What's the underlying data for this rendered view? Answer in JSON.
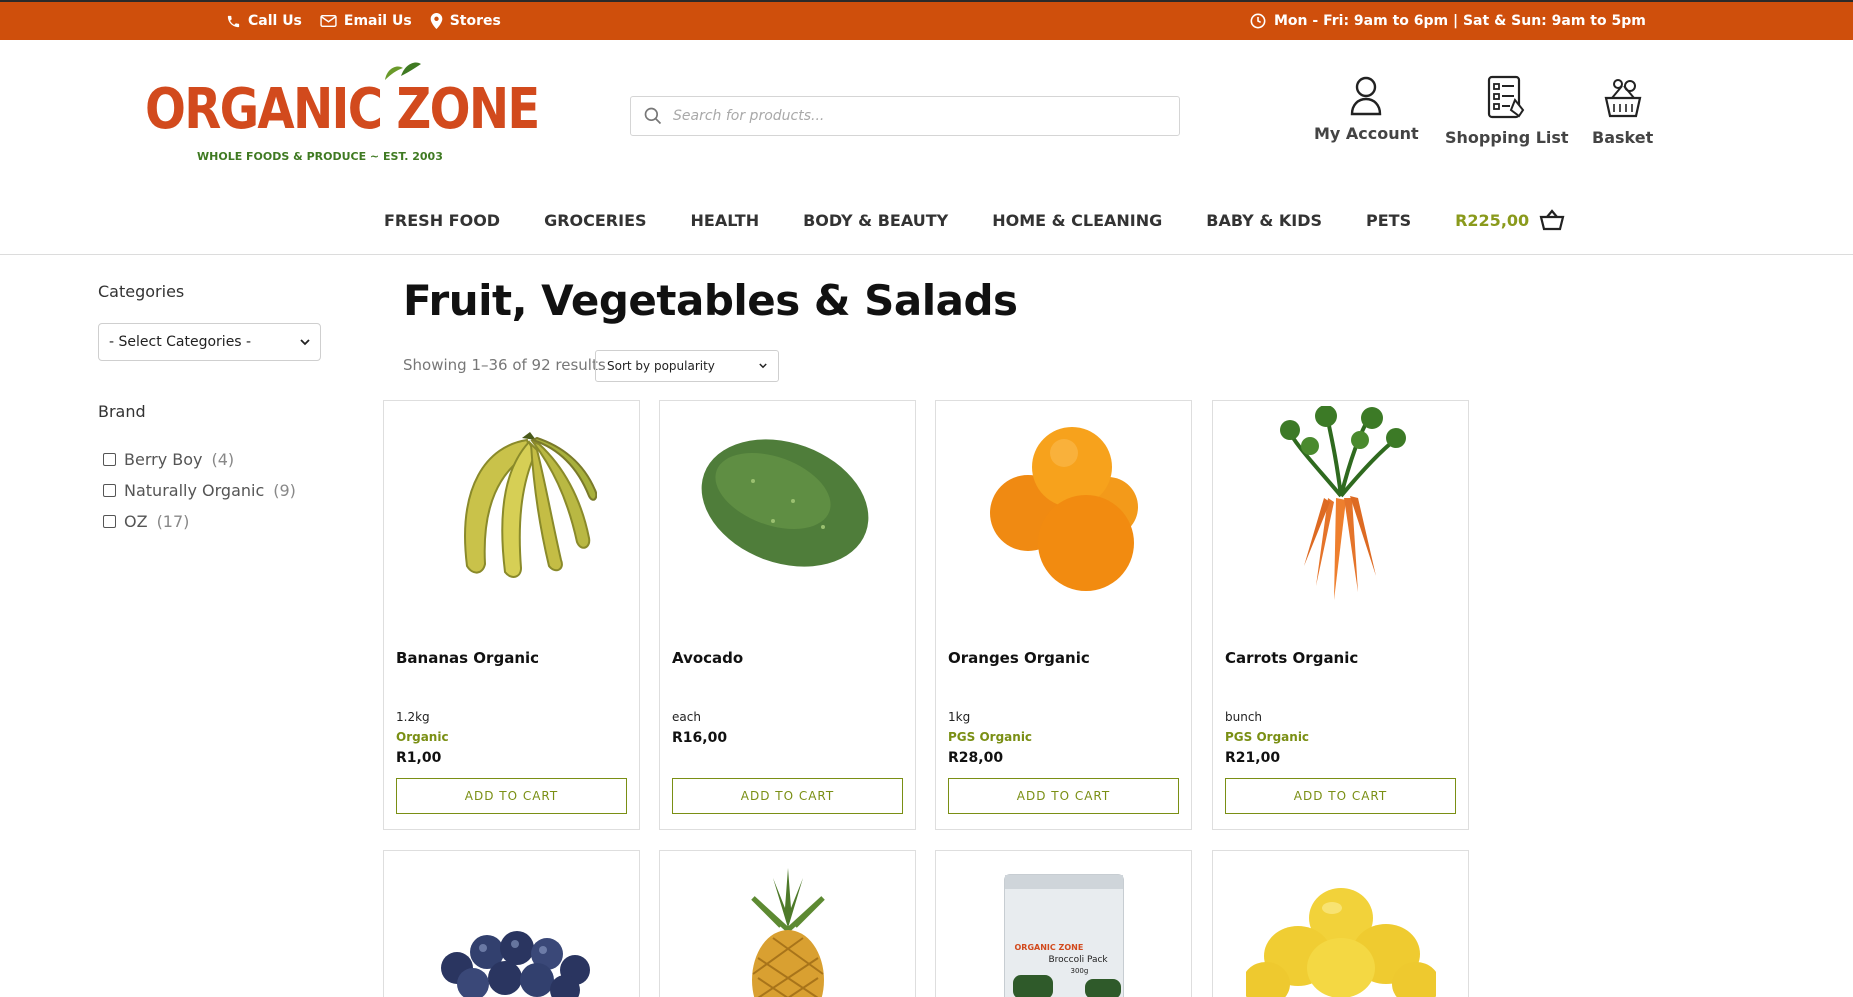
{
  "topbar": {
    "call": "Call Us",
    "email": "Email Us",
    "stores": "Stores",
    "hours": "Mon - Fri: 9am to 6pm | Sat & Sun: 9am to 5pm"
  },
  "logo": {
    "brand": "ORGANIC ZONE",
    "tagline": "WHOLE FOODS & PRODUCE ~ EST. 2003"
  },
  "search": {
    "placeholder": "Search for products..."
  },
  "header_icons": {
    "account": "My Account",
    "shopping_list": "Shopping List",
    "basket": "Basket"
  },
  "nav": {
    "items": [
      "FRESH FOOD",
      "GROCERIES",
      "HEALTH",
      "BODY & BEAUTY",
      "HOME & CLEANING",
      "BABY & KIDS",
      "PETS"
    ],
    "cart_total": "R225,00"
  },
  "sidebar": {
    "categories_heading": "Categories",
    "categories_select": "- Select Categories -",
    "brand_heading": "Brand",
    "brands": [
      {
        "name": "Berry Boy",
        "count": "(4)"
      },
      {
        "name": "Naturally Organic",
        "count": "(9)"
      },
      {
        "name": "OZ",
        "count": "(17)"
      }
    ]
  },
  "main": {
    "title": "Fruit, Vegetables & Salads",
    "results": "Showing 1–36 of 92 results",
    "sort": "Sort by popularity",
    "add_to_cart": "ADD TO CART",
    "products": [
      {
        "name": "Bananas Organic",
        "unit": "1.2kg",
        "badge": "Organic",
        "price": "R1,00",
        "icon": "banana-image"
      },
      {
        "name": "Avocado",
        "unit": "each",
        "badge": "",
        "price": "R16,00",
        "icon": "avocado-image"
      },
      {
        "name": "Oranges Organic",
        "unit": "1kg",
        "badge": "PGS Organic",
        "price": "R28,00",
        "icon": "oranges-image"
      },
      {
        "name": "Carrots Organic",
        "unit": "bunch",
        "badge": "PGS Organic",
        "price": "R21,00",
        "icon": "carrots-image"
      }
    ],
    "row2": [
      {
        "icon": "blueberries-image"
      },
      {
        "icon": "pineapple-image"
      },
      {
        "icon": "broccoli-pack-image",
        "pack_brand": "ORGANIC ZONE",
        "pack_label": "Broccoli Pack",
        "pack_weight": "300g"
      },
      {
        "icon": "lemons-image"
      }
    ]
  },
  "colors": {
    "topbar": "#cf4f0c",
    "accent_green": "#7a8f14",
    "logo_red": "#d24a1d"
  }
}
